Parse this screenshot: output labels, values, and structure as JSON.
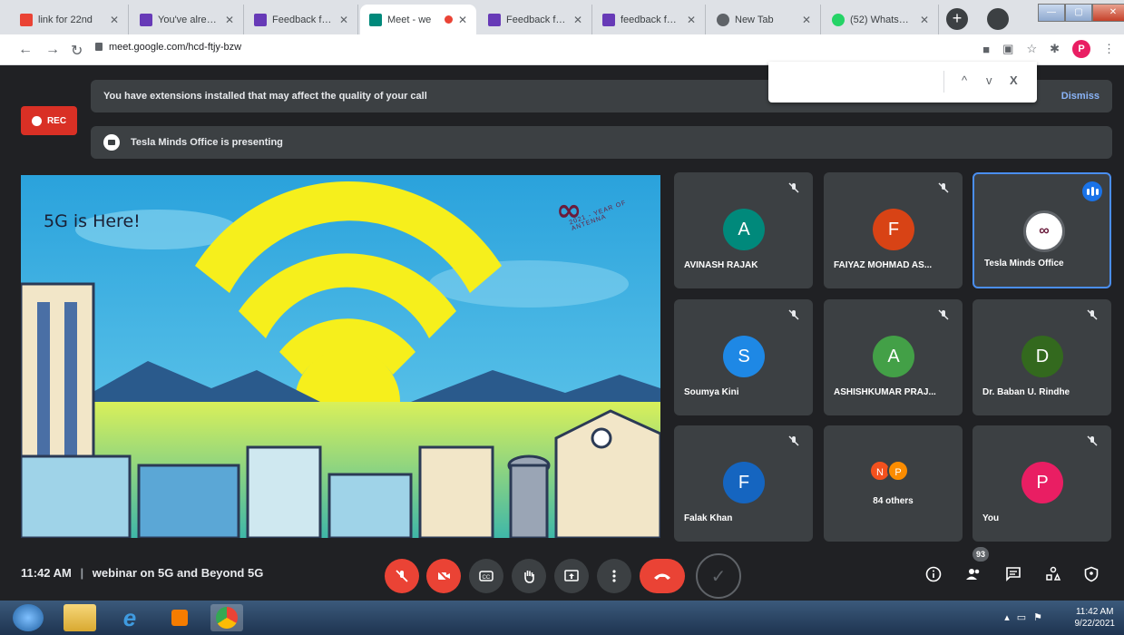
{
  "browser": {
    "tabs": [
      {
        "label": "link for 22nd",
        "favicon": "gmail-icon",
        "color": "#ea4335"
      },
      {
        "label": "You've already",
        "favicon": "forms-icon",
        "color": "#673ab7"
      },
      {
        "label": "Feedback form",
        "favicon": "forms-icon",
        "color": "#673ab7"
      },
      {
        "label": "Meet - we",
        "favicon": "meet-icon",
        "color": "#00897b",
        "active": true
      },
      {
        "label": "Feedback form",
        "favicon": "forms-icon",
        "color": "#673ab7"
      },
      {
        "label": "feedback form",
        "favicon": "forms-icon",
        "color": "#673ab7"
      },
      {
        "label": "New Tab",
        "favicon": "chrome-icon",
        "color": "#5f6368"
      },
      {
        "label": "(52) WhatsApp",
        "favicon": "whatsapp-icon",
        "color": "#25d366"
      }
    ],
    "new_tab": "+",
    "url": "meet.google.com/hcd-ftjy-bzw",
    "profile_initial": "P",
    "find_bar": {
      "up": "^",
      "down": "v",
      "close": "X"
    }
  },
  "meet": {
    "rec_label": "REC",
    "extension_notice": "You have extensions installed that may affect the quality of your call",
    "dismiss_label": "Dismiss",
    "presenting_notice": "Tesla Minds Office is presenting",
    "slide_title": "5G is Here!",
    "slide_logo_text": "2021 - YEAR OF ANTENNA",
    "participants": [
      {
        "initial": "A",
        "name": "AVINASH RAJAK",
        "color": "#00897b",
        "muted": true
      },
      {
        "initial": "F",
        "name": "FAIYAZ MOHMAD AS...",
        "color": "#d84315",
        "muted": true
      },
      {
        "initial": "",
        "name": "Tesla Minds Office",
        "color": "#ffffff",
        "speaking": true
      },
      {
        "initial": "S",
        "name": "Soumya Kini",
        "color": "#1e88e5",
        "muted": true
      },
      {
        "initial": "A",
        "name": "ASHISHKUMAR PRAJ...",
        "color": "#43a047",
        "muted": true
      },
      {
        "initial": "D",
        "name": "Dr. Baban U. Rindhe",
        "color": "#33691e",
        "muted": true
      },
      {
        "initial": "F",
        "name": "Falak Khan",
        "color": "#1565c0",
        "muted": true
      },
      {
        "initial": "",
        "name": "84 others",
        "color": "#3c4043",
        "others": [
          "N",
          "P"
        ]
      },
      {
        "initial": "P",
        "name": "You",
        "color": "#e91e63",
        "muted": true
      }
    ],
    "time": "11:42 AM",
    "separator": "|",
    "meeting_title": "webinar on 5G and Beyond 5G",
    "participant_count": "93"
  },
  "taskbar": {
    "time": "11:42 AM",
    "date": "9/22/2021"
  }
}
